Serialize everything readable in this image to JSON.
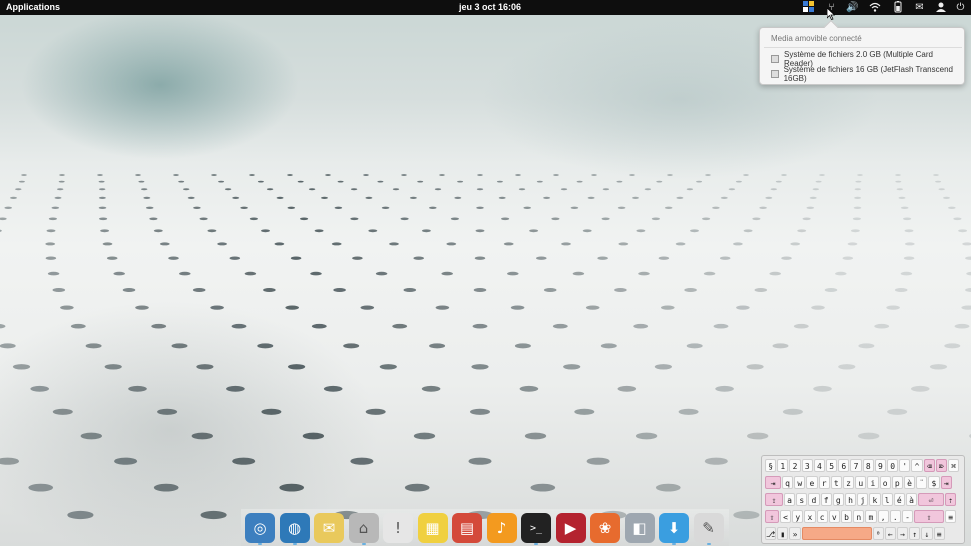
{
  "top_panel": {
    "applications_label": "Applications",
    "clock": "jeu  3 oct 16:06",
    "tray_icons": [
      "multitasking-icon",
      "usb-icon",
      "volume-icon",
      "wifi-icon",
      "battery-icon",
      "mail-icon",
      "user-icon",
      "power-icon"
    ]
  },
  "media_popover": {
    "title": "Media amovible connecté",
    "items": [
      "Système de fichiers 2.0 GB (Multiple Card  Reader)",
      "Système de fichiers 16 GB (JetFlash Transcend 16GB)"
    ]
  },
  "dock": {
    "apps": [
      {
        "name": "chromium-icon",
        "color": "#3d7fbf",
        "glyph": "◎",
        "running": true
      },
      {
        "name": "web-browser-icon",
        "color": "#2e79b8",
        "glyph": "◍",
        "running": true
      },
      {
        "name": "mail-app-icon",
        "color": "#e9c95c",
        "glyph": "✉",
        "running": false
      },
      {
        "name": "files-icon",
        "color": "#b8b8b8",
        "glyph": "⌂",
        "running": true
      },
      {
        "name": "notes-bubble-icon",
        "color": "#e6e6e6",
        "glyph": "!",
        "running": false
      },
      {
        "name": "office-icon",
        "color": "#f0d040",
        "glyph": "▦",
        "running": false
      },
      {
        "name": "calendar-icon",
        "color": "#d44a3a",
        "glyph": "▤",
        "running": false
      },
      {
        "name": "music-icon",
        "color": "#f39a1f",
        "glyph": "♪",
        "running": false
      },
      {
        "name": "terminal-icon",
        "color": "#222222",
        "glyph": ">_",
        "running": true
      },
      {
        "name": "video-icon",
        "color": "#b4232f",
        "glyph": "▶",
        "running": false
      },
      {
        "name": "photos-icon",
        "color": "#e76b2e",
        "glyph": "❀",
        "running": false
      },
      {
        "name": "switchboard-icon",
        "color": "#9ea7b0",
        "glyph": "◧",
        "running": false
      },
      {
        "name": "software-center-icon",
        "color": "#3a9ee0",
        "glyph": "⬇",
        "running": true
      },
      {
        "name": "text-editor-icon",
        "color": "#d9d9d9",
        "glyph": "✎",
        "running": true
      }
    ]
  },
  "keyboard": {
    "rows": [
      [
        "§",
        "1",
        "2",
        "3",
        "4",
        "5",
        "6",
        "7",
        "8",
        "9",
        "0",
        "'",
        "^",
        "⌫",
        "⌦",
        "⌘"
      ],
      [
        "⇥",
        "q",
        "w",
        "e",
        "r",
        "t",
        "z",
        "u",
        "i",
        "o",
        "p",
        "è",
        "¨",
        "$",
        "⇥"
      ],
      [
        "⇪",
        "a",
        "s",
        "d",
        "f",
        "g",
        "h",
        "j",
        "k",
        "l",
        "é",
        "à",
        "⏎",
        "⇡"
      ],
      [
        "⇧",
        "<",
        "y",
        "x",
        "c",
        "v",
        "b",
        "n",
        "m",
        ",",
        ".",
        "-",
        "⇧",
        "≡"
      ],
      [
        "⎇",
        "▮",
        "»",
        "",
        "⁰",
        "←",
        "→",
        "↑",
        "↓",
        "≡"
      ]
    ]
  },
  "colors": {
    "panel": "#0e0e0e",
    "keyboard_fn": "#f1c6dc",
    "keyboard_space": "#f6a987",
    "dock_indicator": "#6ab0e0"
  }
}
